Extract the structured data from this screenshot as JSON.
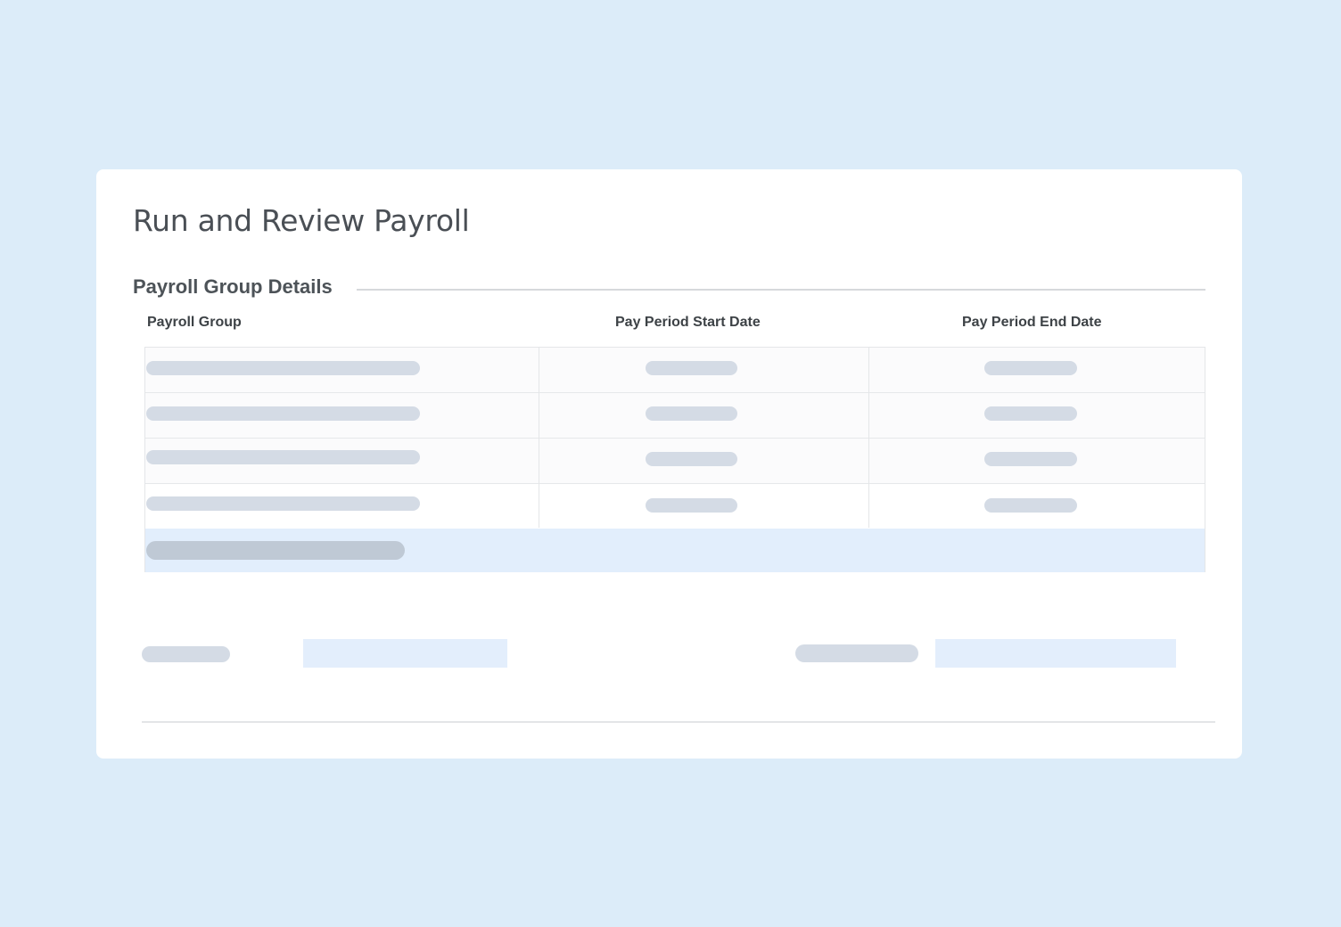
{
  "page": {
    "title": "Run and Review Payroll"
  },
  "section": {
    "title": "Payroll Group Details"
  },
  "table": {
    "columns": [
      "Payroll Group",
      "Pay Period Start Date",
      "Pay Period End Date"
    ],
    "row_count": 4,
    "has_total_row": true
  },
  "colors": {
    "background": "#dcecf9",
    "card": "#ffffff",
    "placeholder": "#d4dbe5",
    "highlight_row": "#e2eefc"
  }
}
